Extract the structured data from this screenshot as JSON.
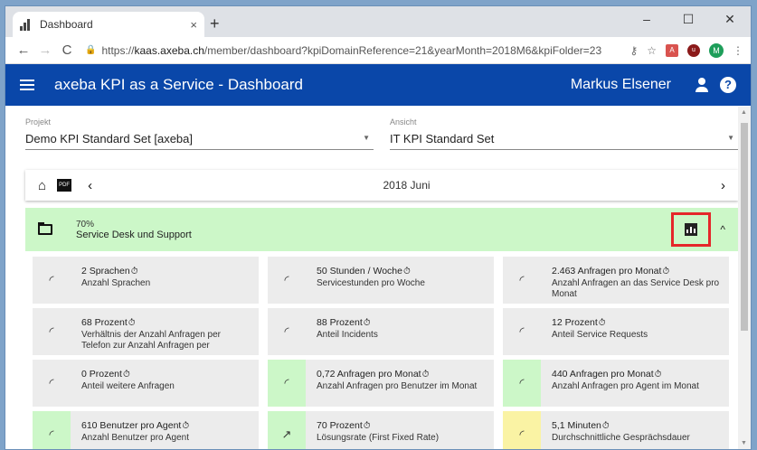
{
  "browser": {
    "tab_title": "Dashboard",
    "tab_close": "×",
    "new_tab": "+",
    "win_min": "–",
    "win_max": "☐",
    "win_close": "✕",
    "back": "←",
    "forward": "→",
    "reload": "C",
    "url_scheme": "https://",
    "url_host": "kaas.axeba.ch",
    "url_path": "/member/dashboard?kpiDomainReference=21&yearMonth=2018M6&kpiFolder=23",
    "avatar_letter": "M"
  },
  "header": {
    "title": "axeba KPI as a Service  -  Dashboard",
    "user": "Markus Elsener"
  },
  "filters": {
    "project_label": "Projekt",
    "project_value": "Demo KPI Standard Set [axeba]",
    "view_label": "Ansicht",
    "view_value": "IT KPI Standard Set"
  },
  "period": {
    "month": "2018 Juni"
  },
  "group": {
    "percent": "70%",
    "name": "Service Desk und Support"
  },
  "kpis": [
    {
      "value": "2 Sprachen",
      "desc": "Anzahl Sprachen",
      "status": "grey",
      "icon": "gauge-icon"
    },
    {
      "value": "50 Stunden / Woche",
      "desc": "Servicestunden pro Woche",
      "status": "grey",
      "icon": "gauge-icon"
    },
    {
      "value": "2.463 Anfragen pro Monat",
      "desc": "Anzahl Anfragen an das Service Desk pro Monat",
      "status": "grey",
      "icon": "gauge-icon"
    },
    {
      "value": "68 Prozent",
      "desc": "Verhältnis der Anzahl Anfragen per Telefon zur Anzahl Anfragen per",
      "status": "grey",
      "icon": "gauge-icon"
    },
    {
      "value": "88 Prozent",
      "desc": "Anteil Incidents",
      "status": "grey",
      "icon": "gauge-icon"
    },
    {
      "value": "12 Prozent",
      "desc": "Anteil Service Requests",
      "status": "grey",
      "icon": "gauge-icon"
    },
    {
      "value": "0 Prozent",
      "desc": "Anteil weitere Anfragen",
      "status": "grey",
      "icon": "gauge-icon"
    },
    {
      "value": "0,72 Anfragen pro Monat",
      "desc": "Anzahl Anfragen pro Benutzer im Monat",
      "status": "green",
      "icon": "gauge-icon"
    },
    {
      "value": "440 Anfragen pro Monat",
      "desc": "Anzahl Anfragen pro Agent im Monat",
      "status": "green",
      "icon": "gauge-icon"
    },
    {
      "value": "610 Benutzer pro Agent",
      "desc": "Anzahl Benutzer pro Agent",
      "status": "green",
      "icon": "gauge-icon"
    },
    {
      "value": "70 Prozent",
      "desc": "Lösungsrate (First Fixed Rate)",
      "status": "green",
      "icon": "trend-icon"
    },
    {
      "value": "5,1 Minuten",
      "desc": "Durchschnittliche Gesprächsdauer",
      "status": "yellow",
      "icon": "gauge-icon"
    }
  ]
}
